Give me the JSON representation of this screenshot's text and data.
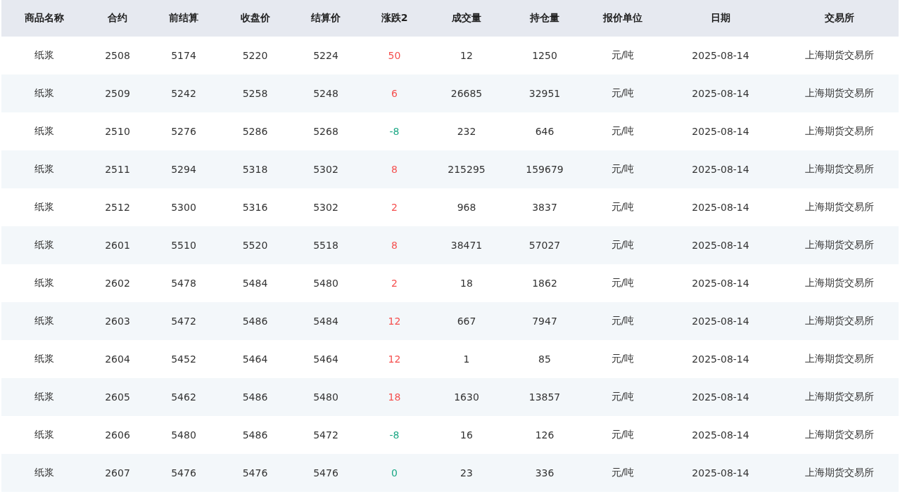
{
  "table": {
    "columns": [
      {
        "label": "商品名称",
        "kind": "plain"
      },
      {
        "label": "合约",
        "kind": "plain"
      },
      {
        "label": "前结算",
        "kind": "plain"
      },
      {
        "label": "收盘价",
        "kind": "plain"
      },
      {
        "label": "结算价",
        "kind": "plain"
      },
      {
        "label": "涨跌2",
        "kind": "change"
      },
      {
        "label": "成交量",
        "kind": "plain"
      },
      {
        "label": "持仓量",
        "kind": "plain"
      },
      {
        "label": "报价单位",
        "kind": "plain"
      },
      {
        "label": "日期",
        "kind": "plain"
      },
      {
        "label": "交易所",
        "kind": "plain"
      }
    ],
    "rows": [
      {
        "cells": [
          "纸浆",
          "2508",
          "5174",
          "5220",
          "5224",
          "50",
          "12",
          "1250",
          "元/吨",
          "2025-08-14",
          "上海期货交易所"
        ],
        "color": "#f5504f"
      },
      {
        "cells": [
          "纸浆",
          "2509",
          "5242",
          "5258",
          "5248",
          "6",
          "26685",
          "32951",
          "元/吨",
          "2025-08-14",
          "上海期货交易所"
        ],
        "color": "#f5504f"
      },
      {
        "cells": [
          "纸浆",
          "2510",
          "5276",
          "5286",
          "5268",
          "-8",
          "232",
          "646",
          "元/吨",
          "2025-08-14",
          "上海期货交易所"
        ],
        "color": "#1aa784"
      },
      {
        "cells": [
          "纸浆",
          "2511",
          "5294",
          "5318",
          "5302",
          "8",
          "215295",
          "159679",
          "元/吨",
          "2025-08-14",
          "上海期货交易所"
        ],
        "color": "#f5504f"
      },
      {
        "cells": [
          "纸浆",
          "2512",
          "5300",
          "5316",
          "5302",
          "2",
          "968",
          "3837",
          "元/吨",
          "2025-08-14",
          "上海期货交易所"
        ],
        "color": "#f5504f"
      },
      {
        "cells": [
          "纸浆",
          "2601",
          "5510",
          "5520",
          "5518",
          "8",
          "38471",
          "57027",
          "元/吨",
          "2025-08-14",
          "上海期货交易所"
        ],
        "color": "#f5504f"
      },
      {
        "cells": [
          "纸浆",
          "2602",
          "5478",
          "5484",
          "5480",
          "2",
          "18",
          "1862",
          "元/吨",
          "2025-08-14",
          "上海期货交易所"
        ],
        "color": "#f5504f"
      },
      {
        "cells": [
          "纸浆",
          "2603",
          "5472",
          "5486",
          "5484",
          "12",
          "667",
          "7947",
          "元/吨",
          "2025-08-14",
          "上海期货交易所"
        ],
        "color": "#f5504f"
      },
      {
        "cells": [
          "纸浆",
          "2604",
          "5452",
          "5464",
          "5464",
          "12",
          "1",
          "85",
          "元/吨",
          "2025-08-14",
          "上海期货交易所"
        ],
        "color": "#f5504f"
      },
      {
        "cells": [
          "纸浆",
          "2605",
          "5462",
          "5486",
          "5480",
          "18",
          "1630",
          "13857",
          "元/吨",
          "2025-08-14",
          "上海期货交易所"
        ],
        "color": "#f5504f"
      },
      {
        "cells": [
          "纸浆",
          "2606",
          "5480",
          "5486",
          "5472",
          "-8",
          "16",
          "126",
          "元/吨",
          "2025-08-14",
          "上海期货交易所"
        ],
        "color": "#1aa784"
      },
      {
        "cells": [
          "纸浆",
          "2607",
          "5476",
          "5476",
          "5476",
          "0",
          "23",
          "336",
          "元/吨",
          "2025-08-14",
          "上海期货交易所"
        ],
        "color": "#1aa784"
      }
    ]
  }
}
